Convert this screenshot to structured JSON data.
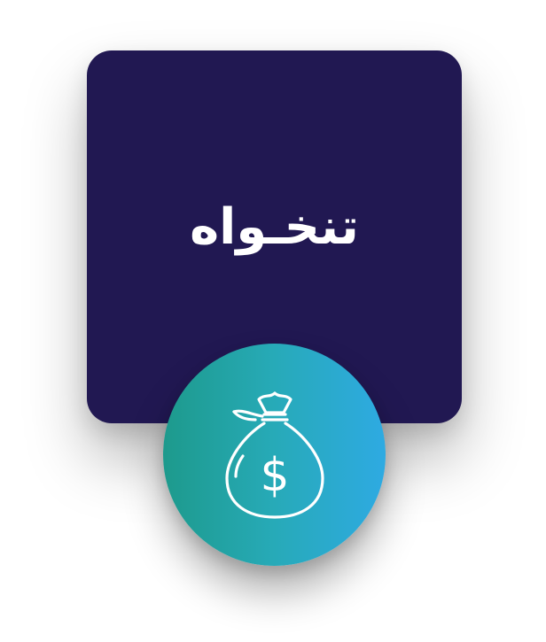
{
  "card": {
    "title": "تنخـواه",
    "background": "#211852",
    "text_color": "#ffffff"
  },
  "badge": {
    "icon": "money-bag-icon",
    "symbol": "$",
    "gradient_start": "#1d9a8c",
    "gradient_end": "#2eaae2"
  }
}
